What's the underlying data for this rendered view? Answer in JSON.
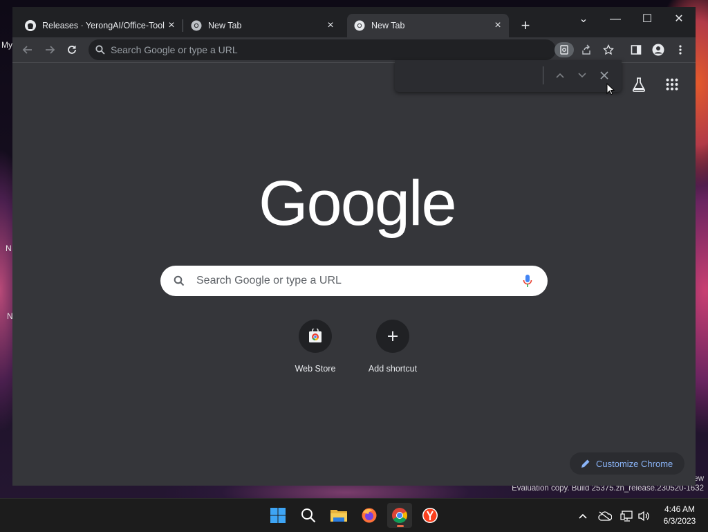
{
  "desktop": {
    "icon_labels": [
      "My",
      "N",
      "N"
    ],
    "watermark_line1": "ew",
    "watermark_line2": "Evaluation copy. Build 25375.zn_release.230520-1632"
  },
  "browser": {
    "tabs": [
      {
        "title": "Releases · YerongAI/Office-Tool",
        "icon": "github-icon",
        "active": false
      },
      {
        "title": "New Tab",
        "icon": "chrome-icon",
        "active": false
      },
      {
        "title": "New Tab",
        "icon": "chrome-icon",
        "active": true
      }
    ],
    "new_tab_symbol": "+",
    "window_controls": {
      "tab_search": "⌄",
      "minimize": "—",
      "maximize": "☐",
      "close": "✕"
    },
    "omnibox": {
      "placeholder": "Search Google or type a URL"
    },
    "findbar": {
      "prev": "⌃",
      "next": "⌄",
      "close": "✕"
    }
  },
  "ntp": {
    "logo": "Google",
    "search_placeholder": "Search Google or type a URL",
    "shortcuts": [
      {
        "label": "Web Store",
        "icon": "web-store-icon"
      },
      {
        "label": "Add shortcut",
        "icon": "plus-icon"
      }
    ],
    "customize_label": "Customize Chrome"
  },
  "taskbar": {
    "apps": [
      "windows-start-icon",
      "search-icon",
      "file-explorer-icon",
      "firefox-icon",
      "chrome-icon",
      "yandex-icon"
    ],
    "clock": {
      "time": "4:46 AM",
      "date": "6/3/2023"
    }
  },
  "colors": {
    "accent": "#8ab4f8",
    "tab_bg": "#202124",
    "page_bg": "#35363a"
  }
}
